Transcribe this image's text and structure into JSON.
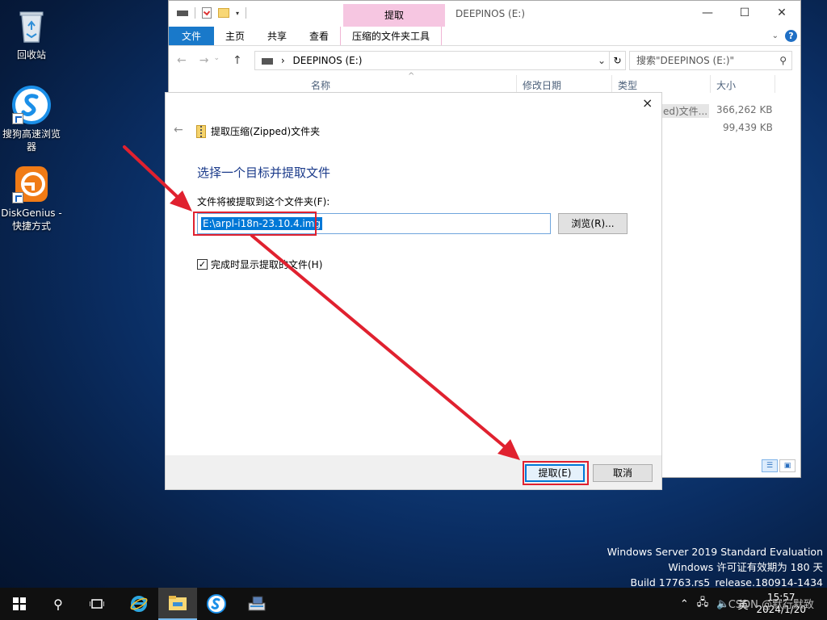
{
  "desktop": {
    "icons": [
      {
        "label": "回收站"
      },
      {
        "label": "搜狗高速浏览器"
      },
      {
        "label": "DiskGenius - 快捷方式"
      }
    ]
  },
  "explorer": {
    "context_tab": "提取",
    "title": "DEEPINOS (E:)",
    "ribbon_tabs": {
      "file": "文件",
      "home": "主页",
      "share": "共享",
      "view": "查看",
      "tools": "压缩的文件夹工具"
    },
    "address": "DEEPINOS (E:)",
    "search_placeholder": "搜索\"DEEPINOS (E:)\"",
    "columns": {
      "name": "名称",
      "date": "修改日期",
      "type": "类型",
      "size": "大小"
    },
    "rows": [
      {
        "type_partial": "ed)文件...",
        "size": "366,262 KB"
      },
      {
        "size": "99,439 KB"
      }
    ]
  },
  "dialog": {
    "header": "提取压缩(Zipped)文件夹",
    "heading": "选择一个目标并提取文件",
    "dest_label": "文件将被提取到这个文件夹(F):",
    "dest_value": "E:\\arpl-i18n-23.10.4.img",
    "browse_label": "浏览(R)...",
    "checkbox_label": "完成时显示提取的文件(H)",
    "extract_label": "提取(E)",
    "cancel_label": "取消"
  },
  "watermark": {
    "line1": "Windows Server 2019 Standard Evaluation",
    "line2": "Windows 许可证有效期为 180 天",
    "line3": "Build 17763.rs5_release.180914-1434"
  },
  "taskbar": {
    "time": "15:57",
    "date": "2024/1/20",
    "ime": "英",
    "overlay": "CSDN @默行默致"
  },
  "colors": {
    "accent": "#0078d7",
    "annotation_red": "#e0212f",
    "context_tab": "#f6c6e1"
  }
}
